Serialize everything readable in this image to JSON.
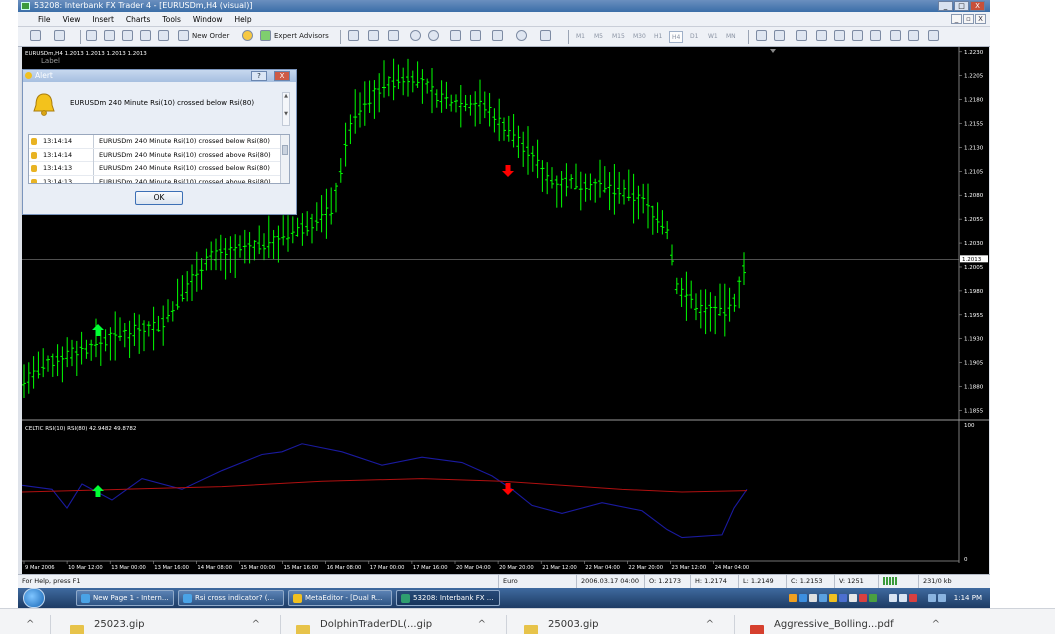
{
  "window": {
    "title": "53208: Interbank FX Trader 4 - [EURUSDm,H4 (visual)]",
    "controls": [
      "_",
      "□",
      "X"
    ],
    "mdi_controls": [
      "_",
      "▫",
      "X"
    ]
  },
  "menu": [
    "File",
    "View",
    "Insert",
    "Charts",
    "Tools",
    "Window",
    "Help"
  ],
  "toolbar": {
    "new_order": "New Order",
    "expert_advisors": "Expert Advisors",
    "timeframes": [
      "M1",
      "M5",
      "M15",
      "M30",
      "H1",
      "H4",
      "D1",
      "W1",
      "MN"
    ],
    "active_timeframe": "H4"
  },
  "chart": {
    "header": "EURUSDm,H4  1.2013 1.2013 1.2013 1.2013",
    "label": "Label",
    "indicator_header": "CELTIC RSI(10)  RSI(80) 42.9482 49.8782",
    "price_ticks": [
      "1.2230",
      "1.2205",
      "1.2180",
      "1.2155",
      "1.2130",
      "1.2105",
      "1.2080",
      "1.2055",
      "1.2030",
      "1.2005",
      "1.1980",
      "1.1955",
      "1.1930",
      "1.1905",
      "1.1880",
      "1.1855"
    ],
    "current_price": "1.2013",
    "rsi_ticks": [
      "100",
      "0"
    ],
    "time_ticks": [
      "9 Mar 2006",
      "10 Mar 12:00",
      "13 Mar 00:00",
      "13 Mar 16:00",
      "14 Mar 08:00",
      "15 Mar 00:00",
      "15 Mar 16:00",
      "16 Mar 08:00",
      "17 Mar 00:00",
      "17 Mar 16:00",
      "20 Mar 04:00",
      "20 Mar 20:00",
      "21 Mar 12:00",
      "22 Mar 04:00",
      "22 Mar 20:00",
      "23 Mar 12:00",
      "24 Mar 04:00"
    ],
    "colors": {
      "bars": "#00ff00",
      "up_arrow": "#00ff33",
      "down_arrow": "#ff0000",
      "rsi_fast": "#1a1aa0",
      "rsi_slow": "#b01010",
      "grid": "#505050",
      "axis_text": "#ffffff"
    }
  },
  "alert": {
    "title": "Alert",
    "title_buttons": [
      "?",
      "X"
    ],
    "message": "EURUSDm  240 Minute  Rsi(10) crossed below Rsi(80)",
    "rows": [
      {
        "time": "13:14:14",
        "message": "EURUSDm  240 Minute  Rsi(10) crossed below Rsi(80)"
      },
      {
        "time": "13:14:14",
        "message": "EURUSDm  240 Minute  Rsi(10) crossed above Rsi(80)"
      },
      {
        "time": "13:14:13",
        "message": "EURUSDm  240 Minute  Rsi(10) crossed below Rsi(80)"
      },
      {
        "time": "13:14:13",
        "message": "EURUSDm  240 Minute  Rsi(10) crossed above Rsi(80)"
      }
    ],
    "ok": "OK"
  },
  "status": {
    "help": "For Help, press F1",
    "profile": "Euro",
    "datetime": "2006.03.17 04:00",
    "open": "O: 1.2173",
    "high": "H: 1.2174",
    "low": "L: 1.2149",
    "close": "C: 1.2153",
    "volume": "V: 1251",
    "traffic": "231/0 kb"
  },
  "taskbar": {
    "tasks": [
      "New Page 1 - Intern...",
      "Rsi cross indicator? (...",
      "MetaEditor - [Dual R...",
      "53208: Interbank FX ..."
    ],
    "clock": "1:14 PM"
  },
  "downloads": [
    "25023.gip",
    "DolphinTraderDL(...gip",
    "25003.gip",
    "Aggressive_Bolling...pdf"
  ]
}
